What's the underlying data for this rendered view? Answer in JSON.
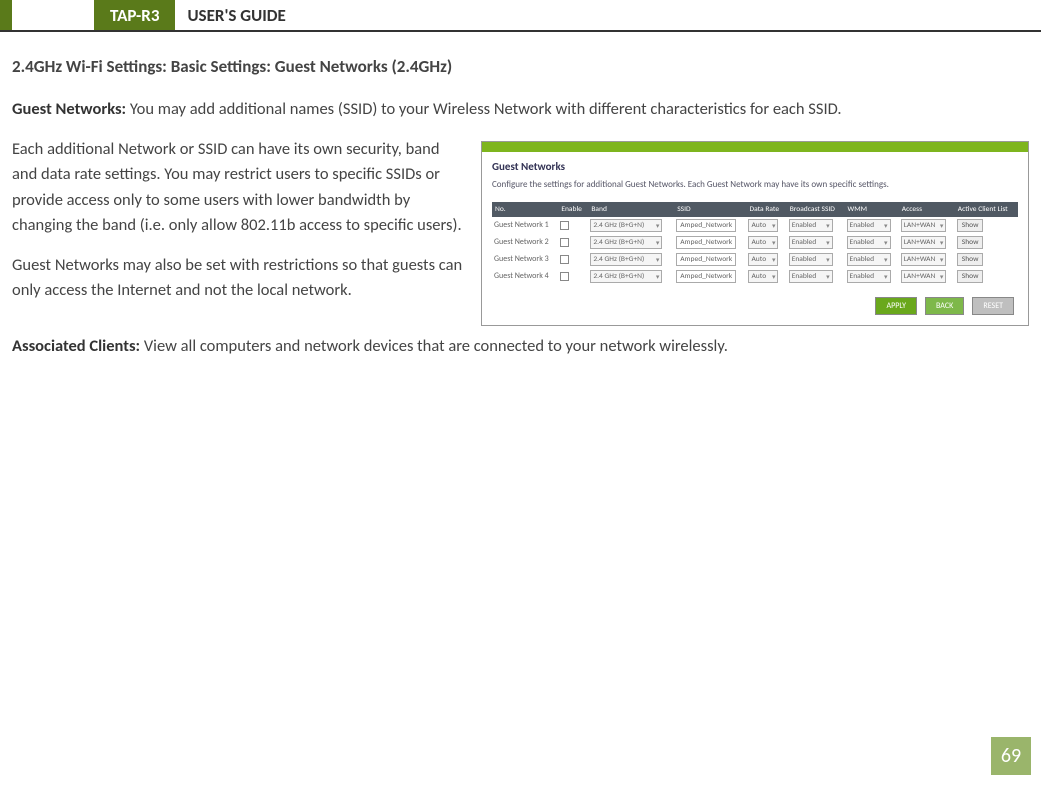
{
  "header": {
    "model": "TAP-R3",
    "title": "USER'S GUIDE"
  },
  "section_title": "2.4GHz Wi-Fi Settings: Basic Settings: Guest Networks (2.4GHz)",
  "para1_label": "Guest Networks:",
  "para1_text": "  You may add additional names (SSID) to your Wireless Network with different characteristics for each SSID.",
  "para2_text": "Each additional Network or SSID can have its own security, band and data rate settings.  You may restrict users to specific SSIDs or provide access only to some users with lower bandwidth by changing the band (i.e. only allow 802.11b access to specific users).",
  "para3_text": "Guest Networks may also be set with restrictions so that guests can only access the Internet and not the local network.",
  "para4_label": "Associated Clients:",
  "para4_text": " View all computers and network devices that are connected to your network wirelessly.",
  "page_number": "69",
  "screenshot": {
    "title": "Guest Networks",
    "desc": "Configure the settings for additional Guest Networks. Each Guest Network may have its own specific settings.",
    "columns": [
      "No.",
      "Enable",
      "Band",
      "SSID",
      "Data Rate",
      "Broadcast SSID",
      "WMM",
      "Access",
      "Active Client List"
    ],
    "rows": [
      {
        "no": "Guest Network 1",
        "band": "2.4 GHz (B+G+N)",
        "ssid": "Amped_Network",
        "rate": "Auto",
        "bcast": "Enabled",
        "wmm": "Enabled",
        "access": "LAN+WAN",
        "show": "Show"
      },
      {
        "no": "Guest Network 2",
        "band": "2.4 GHz (B+G+N)",
        "ssid": "Amped_Network",
        "rate": "Auto",
        "bcast": "Enabled",
        "wmm": "Enabled",
        "access": "LAN+WAN",
        "show": "Show"
      },
      {
        "no": "Guest Network 3",
        "band": "2.4 GHz (B+G+N)",
        "ssid": "Amped_Network",
        "rate": "Auto",
        "bcast": "Enabled",
        "wmm": "Enabled",
        "access": "LAN+WAN",
        "show": "Show"
      },
      {
        "no": "Guest Network 4",
        "band": "2.4 GHz (B+G+N)",
        "ssid": "Amped_Network",
        "rate": "Auto",
        "bcast": "Enabled",
        "wmm": "Enabled",
        "access": "LAN+WAN",
        "show": "Show"
      }
    ],
    "buttons": {
      "apply": "APPLY",
      "back": "BACK",
      "reset": "RESET"
    }
  }
}
